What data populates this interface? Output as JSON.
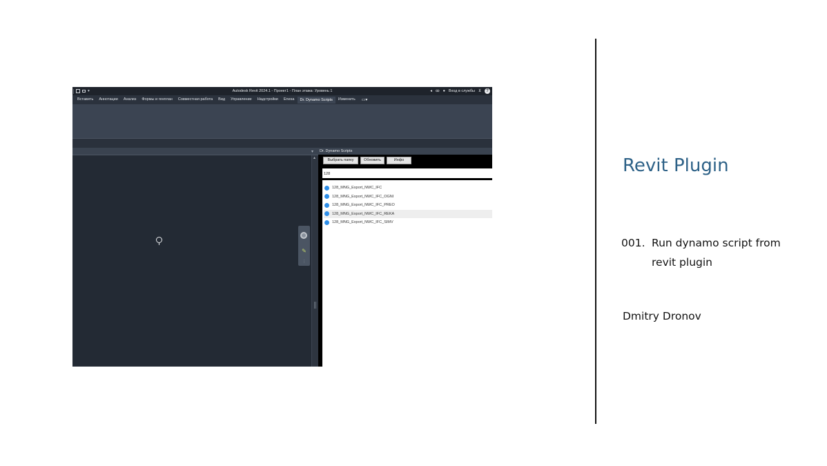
{
  "revit": {
    "window_title": "Autodesk Revit 2024.1 - Проект1 - План этажа: Уровень 1",
    "signin_label": "Вход в службы",
    "help_symbol": "?",
    "ribbon_tabs": [
      {
        "label": "Вставить"
      },
      {
        "label": "Аннотации"
      },
      {
        "label": "Анализ"
      },
      {
        "label": "Формы и генплан"
      },
      {
        "label": "Совместная работа"
      },
      {
        "label": "Вид"
      },
      {
        "label": "Управление"
      },
      {
        "label": "Надстройки"
      },
      {
        "label": "Enesa"
      },
      {
        "label": "Dr. Dynamo Scripts",
        "active": true
      },
      {
        "label": "Изменить"
      }
    ],
    "dynamo_panel": {
      "title": "Dr. Dynamo Scripts",
      "buttons": {
        "choose_folder": "Выбрать папку",
        "refresh": "Обновить",
        "info": "Инфо"
      },
      "filter_value": "128",
      "scripts": [
        {
          "name": "128_MNG_Export_NWC_IFC",
          "selected": false
        },
        {
          "name": "128_MNG_Export_NWC_IFC_OGNI",
          "selected": false
        },
        {
          "name": "128_MNG_Export_NWC_IFC_PREO",
          "selected": false
        },
        {
          "name": "128_MNG_Export_NWC_IFC_REKA",
          "selected": true
        },
        {
          "name": "128_MNG_Export_NWC_IFC_SIMV",
          "selected": false
        }
      ]
    },
    "colors": {
      "script_dot": "#2e8ee8",
      "canvas_bg": "#232a34",
      "ribbon_bg": "#3b4452"
    }
  },
  "slide": {
    "title": "Revit Plugin",
    "step_number": "001.",
    "step_text_line1": "Run dynamo script from",
    "step_text_line2": "revit plugin",
    "author": "Dmitry Dronov",
    "colors": {
      "title": "#2d6187"
    }
  }
}
